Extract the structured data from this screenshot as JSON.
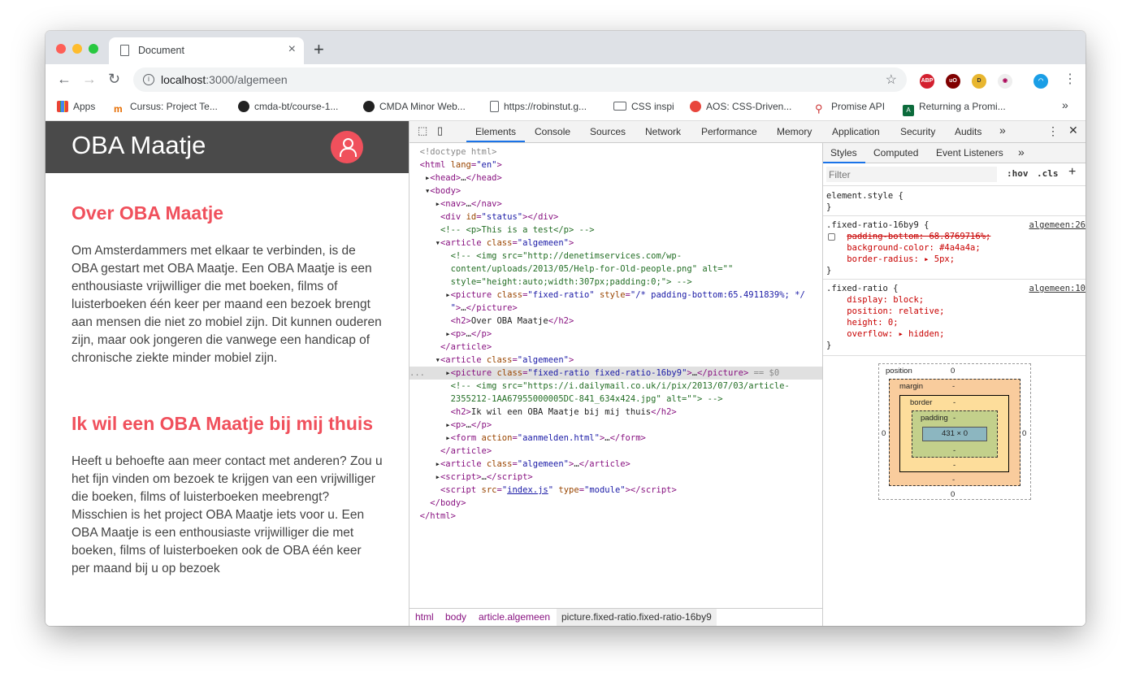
{
  "browser": {
    "tab_title": "Document",
    "url_host": "localhost",
    "url_path": ":3000/algemeen",
    "bookmarks": [
      "Apps",
      "Cursus: Project Te...",
      "cmda-bt/course-1...",
      "CMDA Minor Web...",
      "https://robinstut.g...",
      "CSS inspi",
      "AOS: CSS-Driven...",
      "Promise API",
      "Returning a Promi..."
    ],
    "extensions": [
      "ABP",
      "uO",
      "D"
    ]
  },
  "page": {
    "brand": "OBA Maatje",
    "section1_title": "Over OBA Maatje",
    "section1_text": "Om Amsterdammers met elkaar te verbinden, is de OBA gestart met OBA Maatje. Een OBA Maatje is een enthousiaste vrijwilliger die met boeken, films of luisterboeken één keer per maand een bezoek brengt aan mensen die niet zo mobiel zijn. Dit kunnen ouderen zijn, maar ook jongeren die vanwege een handicap of chronische ziekte minder mobiel zijn.",
    "section2_title": "Ik wil een OBA Maatje bij mij thuis",
    "section2_text": "Heeft u behoefte aan meer contact met anderen? Zou u het fijn vinden om bezoek te krijgen van een vrijwilliger die boeken, films of luisterboeken meebrengt? Misschien is het project OBA Maatje iets voor u. Een OBA Maatje is een enthousiaste vrijwilliger die met boeken, films of luisterboeken ook de OBA één keer per maand bij u op bezoek"
  },
  "devtools": {
    "tabs": [
      "Elements",
      "Console",
      "Sources",
      "Network",
      "Performance",
      "Memory",
      "Application",
      "Security",
      "Audits"
    ],
    "more": "»",
    "breadcrumbs": [
      "html",
      "body",
      "article.algemeen",
      "picture.fixed-ratio.fixed-ratio-16by9"
    ],
    "styles_tabs": [
      "Styles",
      "Computed",
      "Event Listeners"
    ],
    "filter_placeholder": "Filter",
    "hov": ":hov",
    "cls": ".cls",
    "rules": [
      {
        "selector": "element.style {",
        "source": ""
      },
      {
        "selector": ".fixed-ratio-16by9 {",
        "source": "algemeen:26",
        "decls": [
          "padding-bottom: 68.8769716%;",
          "background-color: #4a4a4a;",
          "border-radius: ▸ 5px;"
        ]
      },
      {
        "selector": ".fixed-ratio {",
        "source": "algemeen:10",
        "decls": [
          "display: block;",
          "position: relative;",
          "height: 0;",
          "overflow: ▸ hidden;"
        ]
      }
    ],
    "boxmodel": {
      "position": "position",
      "margin": "margin",
      "border": "border",
      "padding": "padding",
      "size": "431 × 0",
      "zero": "0",
      "dash": "-"
    }
  },
  "colors": {
    "brand": "#f0505c",
    "header": "#4a4a4a"
  }
}
